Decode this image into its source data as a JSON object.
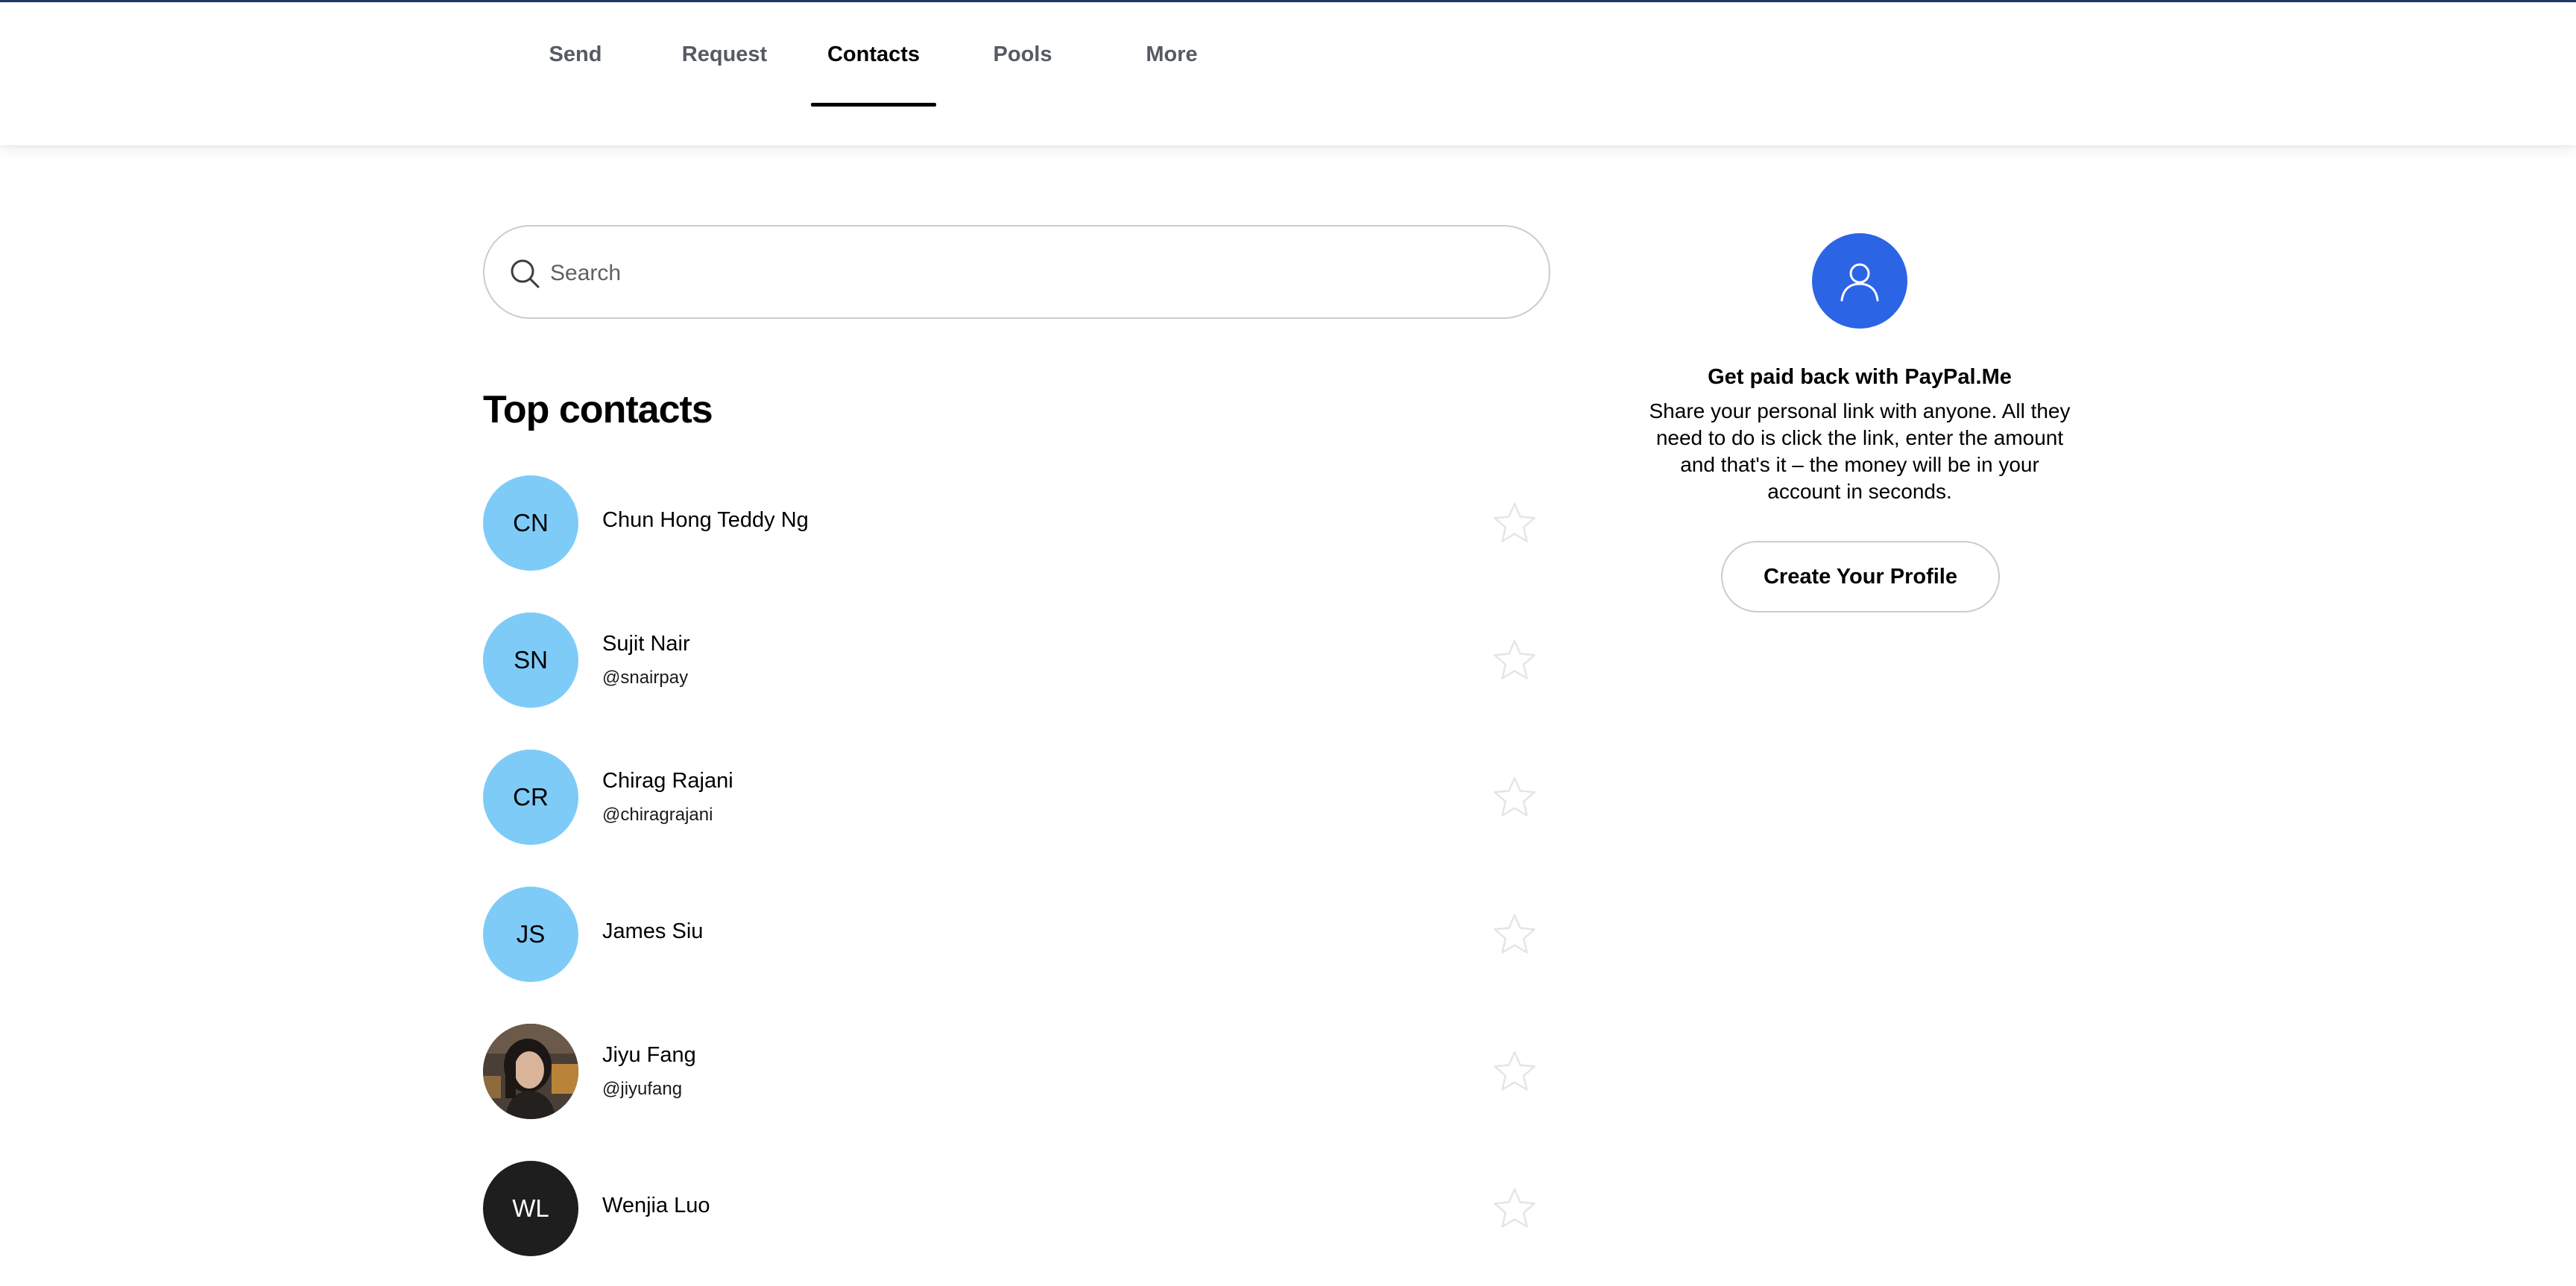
{
  "nav": {
    "tabs": [
      {
        "label": "Send"
      },
      {
        "label": "Request"
      },
      {
        "label": "Contacts"
      },
      {
        "label": "Pools"
      },
      {
        "label": "More"
      }
    ],
    "active_tab": "Contacts"
  },
  "search": {
    "placeholder": "Search"
  },
  "top_contacts": {
    "title": "Top contacts",
    "items": [
      {
        "initials": "CN",
        "name": "Chun Hong Teddy Ng",
        "handle": ""
      },
      {
        "initials": "SN",
        "name": "Sujit Nair",
        "handle": "@snairpay"
      },
      {
        "initials": "CR",
        "name": "Chirag Rajani",
        "handle": "@chiragrajani"
      },
      {
        "initials": "JS",
        "name": "James Siu",
        "handle": ""
      },
      {
        "initials": "",
        "name": "Jiyu Fang",
        "handle": "@jiyufang"
      },
      {
        "initials": "WL",
        "name": "Wenjia Luo",
        "handle": ""
      }
    ]
  },
  "promo": {
    "title": "Get paid back with PayPal.Me",
    "body": "Share your personal link with anyone. All they need to do is click the link, enter the amount and that's it – the money will be in your account in seconds.",
    "button_label": "Create Your Profile"
  },
  "colors": {
    "avatar_blue": "#7ecbf8",
    "avatar_dark": "#1e1e1e",
    "promo_blue": "#2c64e6",
    "top_line": "#1f3a6b"
  }
}
